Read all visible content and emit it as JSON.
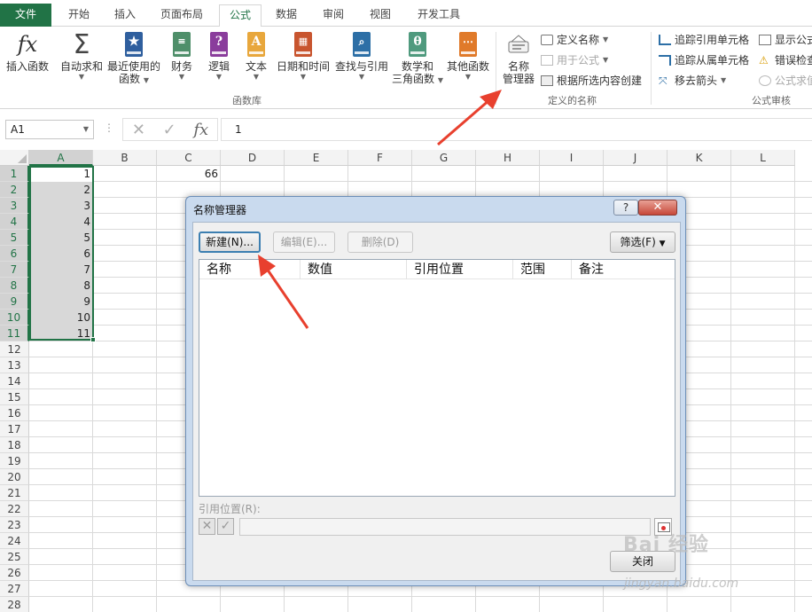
{
  "tabs": {
    "file": "文件",
    "home": "开始",
    "insert": "插入",
    "layout": "页面布局",
    "formulas": "公式",
    "data": "数据",
    "review": "审阅",
    "view": "视图",
    "developer": "开发工具"
  },
  "ribbon": {
    "insert_function": "插入函数",
    "fx_symbol": "fx",
    "autosum": "自动求和",
    "sigma_symbol": "Σ",
    "recent_line1": "最近使用的",
    "recent_line2": "函数",
    "financial": "财务",
    "logical": "逻辑",
    "text": "文本",
    "datetime": "日期和时间",
    "lookup": "查找与引用",
    "math_line1": "数学和",
    "math_line2": "三角函数",
    "more": "其他函数",
    "group_library": "函数库",
    "name_manager_line1": "名称",
    "name_manager_line2": "管理器",
    "define_name": "定义名称",
    "use_in_formula": "用于公式",
    "create_from_selection": "根据所选内容创建",
    "group_defined_names": "定义的名称",
    "trace_precedents": "追踪引用单元格",
    "trace_dependents": "追踪从属单元格",
    "remove_arrows": "移去箭头",
    "show_formulas": "显示公式",
    "error_checking": "错误检查",
    "evaluate_formula": "公式求值",
    "group_auditing": "公式审核",
    "glyph_logical": "?",
    "glyph_text": "A",
    "glyph_math": "θ"
  },
  "formula_bar": {
    "name_box": "A1",
    "dots": "⋮",
    "cancel": "✕",
    "enter": "✓",
    "fx": "fx",
    "content": "1"
  },
  "grid": {
    "columns": [
      "A",
      "B",
      "C",
      "D",
      "E",
      "F",
      "G",
      "H",
      "I",
      "J",
      "K",
      "L"
    ],
    "rows": [
      "1",
      "2",
      "3",
      "4",
      "5",
      "6",
      "7",
      "8",
      "9",
      "10",
      "11",
      "12",
      "13",
      "14",
      "15",
      "16",
      "17",
      "18",
      "19",
      "20",
      "21",
      "22",
      "23",
      "24",
      "25",
      "26",
      "27",
      "28"
    ],
    "col_a_values": [
      "1",
      "2",
      "3",
      "4",
      "5",
      "6",
      "7",
      "8",
      "9",
      "10",
      "11"
    ],
    "c1_value": "66"
  },
  "dialog": {
    "title": "名称管理器",
    "help": "?",
    "close": "✕",
    "new_button": "新建(N)...",
    "edit_button": "编辑(E)...",
    "delete_button": "删除(D)",
    "filter_button": "筛选(F)",
    "filter_caret": "▼",
    "columns": [
      "名称",
      "数值",
      "引用位置",
      "范围",
      "备注"
    ],
    "refers_to_label": "引用位置(R):",
    "ref_cancel": "✕",
    "ref_confirm": "✓",
    "close_button": "关闭"
  },
  "watermark": {
    "main": "Bai 经验",
    "sub": "jingyan.baidu.com"
  },
  "colors": {
    "excel_green": "#217346",
    "arrow_red": "#e8402e",
    "dialog_frame": "#c9daee"
  }
}
